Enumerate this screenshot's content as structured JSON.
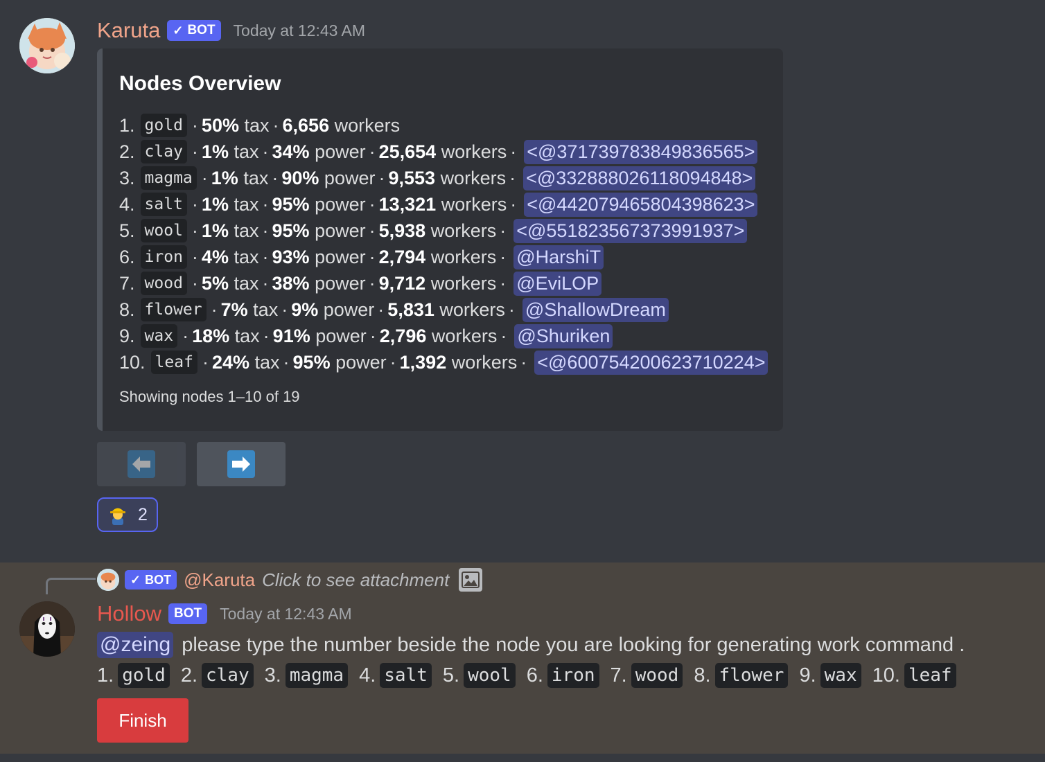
{
  "message1": {
    "username": "Karuta",
    "bot_badge": "BOT",
    "timestamp": "Today at 12:43 AM",
    "embed": {
      "title": "Nodes Overview",
      "nodes": [
        {
          "num": "1.",
          "name": "gold",
          "tax": "50%",
          "tax_label": "tax",
          "power": null,
          "power_label": null,
          "workers": "6,656",
          "workers_label": "workers",
          "owner": null
        },
        {
          "num": "2.",
          "name": "clay",
          "tax": "1%",
          "tax_label": "tax",
          "power": "34%",
          "power_label": "power",
          "workers": "25,654",
          "workers_label": "workers",
          "owner": "<@371739783849836565>"
        },
        {
          "num": "3.",
          "name": "magma",
          "tax": "1%",
          "tax_label": "tax",
          "power": "90%",
          "power_label": "power",
          "workers": "9,553",
          "workers_label": "workers",
          "owner": "<@332888026118094848>"
        },
        {
          "num": "4.",
          "name": "salt",
          "tax": "1%",
          "tax_label": "tax",
          "power": "95%",
          "power_label": "power",
          "workers": "13,321",
          "workers_label": "workers",
          "owner": "<@442079465804398623>"
        },
        {
          "num": "5.",
          "name": "wool",
          "tax": "1%",
          "tax_label": "tax",
          "power": "95%",
          "power_label": "power",
          "workers": "5,938",
          "workers_label": "workers",
          "owner": "<@551823567373991937>"
        },
        {
          "num": "6.",
          "name": "iron",
          "tax": "4%",
          "tax_label": "tax",
          "power": "93%",
          "power_label": "power",
          "workers": "2,794",
          "workers_label": "workers",
          "owner": "@HarshiT"
        },
        {
          "num": "7.",
          "name": "wood",
          "tax": "5%",
          "tax_label": "tax",
          "power": "38%",
          "power_label": "power",
          "workers": "9,712",
          "workers_label": "workers",
          "owner": "@EviLOP"
        },
        {
          "num": "8.",
          "name": "flower",
          "tax": "7%",
          "tax_label": "tax",
          "power": "9%",
          "power_label": "power",
          "workers": "5,831",
          "workers_label": "workers",
          "owner": "@ShallowDream"
        },
        {
          "num": "9.",
          "name": "wax",
          "tax": "18%",
          "tax_label": "tax",
          "power": "91%",
          "power_label": "power",
          "workers": "2,796",
          "workers_label": "workers",
          "owner": "@Shuriken"
        },
        {
          "num": "10.",
          "name": "leaf",
          "tax": "24%",
          "tax_label": "tax",
          "power": "95%",
          "power_label": "power",
          "workers": "1,392",
          "workers_label": "workers",
          "owner": "<@600754200623710224>"
        }
      ],
      "footer": "Showing nodes 1–10 of 19"
    },
    "buttons": {
      "prev_icon": "arrow-left-icon",
      "next_icon": "arrow-right-icon"
    },
    "reaction": {
      "emoji": "construction-worker-emoji",
      "count": "2"
    }
  },
  "message2": {
    "reply": {
      "bot_badge": "BOT",
      "name": "@Karuta",
      "text": "Click to see attachment",
      "icon": "image-icon"
    },
    "username": "Hollow",
    "bot_badge": "BOT",
    "timestamp": "Today at 12:43 AM",
    "mention": "@zeing",
    "text": "please type the number beside the node you are looking for generating work command .",
    "options": [
      {
        "num": "1.",
        "name": "gold"
      },
      {
        "num": "2.",
        "name": "clay"
      },
      {
        "num": "3.",
        "name": "magma"
      },
      {
        "num": "4.",
        "name": "salt"
      },
      {
        "num": "5.",
        "name": "wool"
      },
      {
        "num": "6.",
        "name": "iron"
      },
      {
        "num": "7.",
        "name": "wood"
      },
      {
        "num": "8.",
        "name": "flower"
      },
      {
        "num": "9.",
        "name": "wax"
      },
      {
        "num": "10.",
        "name": "leaf"
      }
    ],
    "finish_label": "Finish"
  },
  "colors": {
    "blurple": "#5865f2",
    "finish_red": "#d83c3e",
    "karuta_name": "#f0a48a",
    "hollow_name": "#e8584f"
  }
}
